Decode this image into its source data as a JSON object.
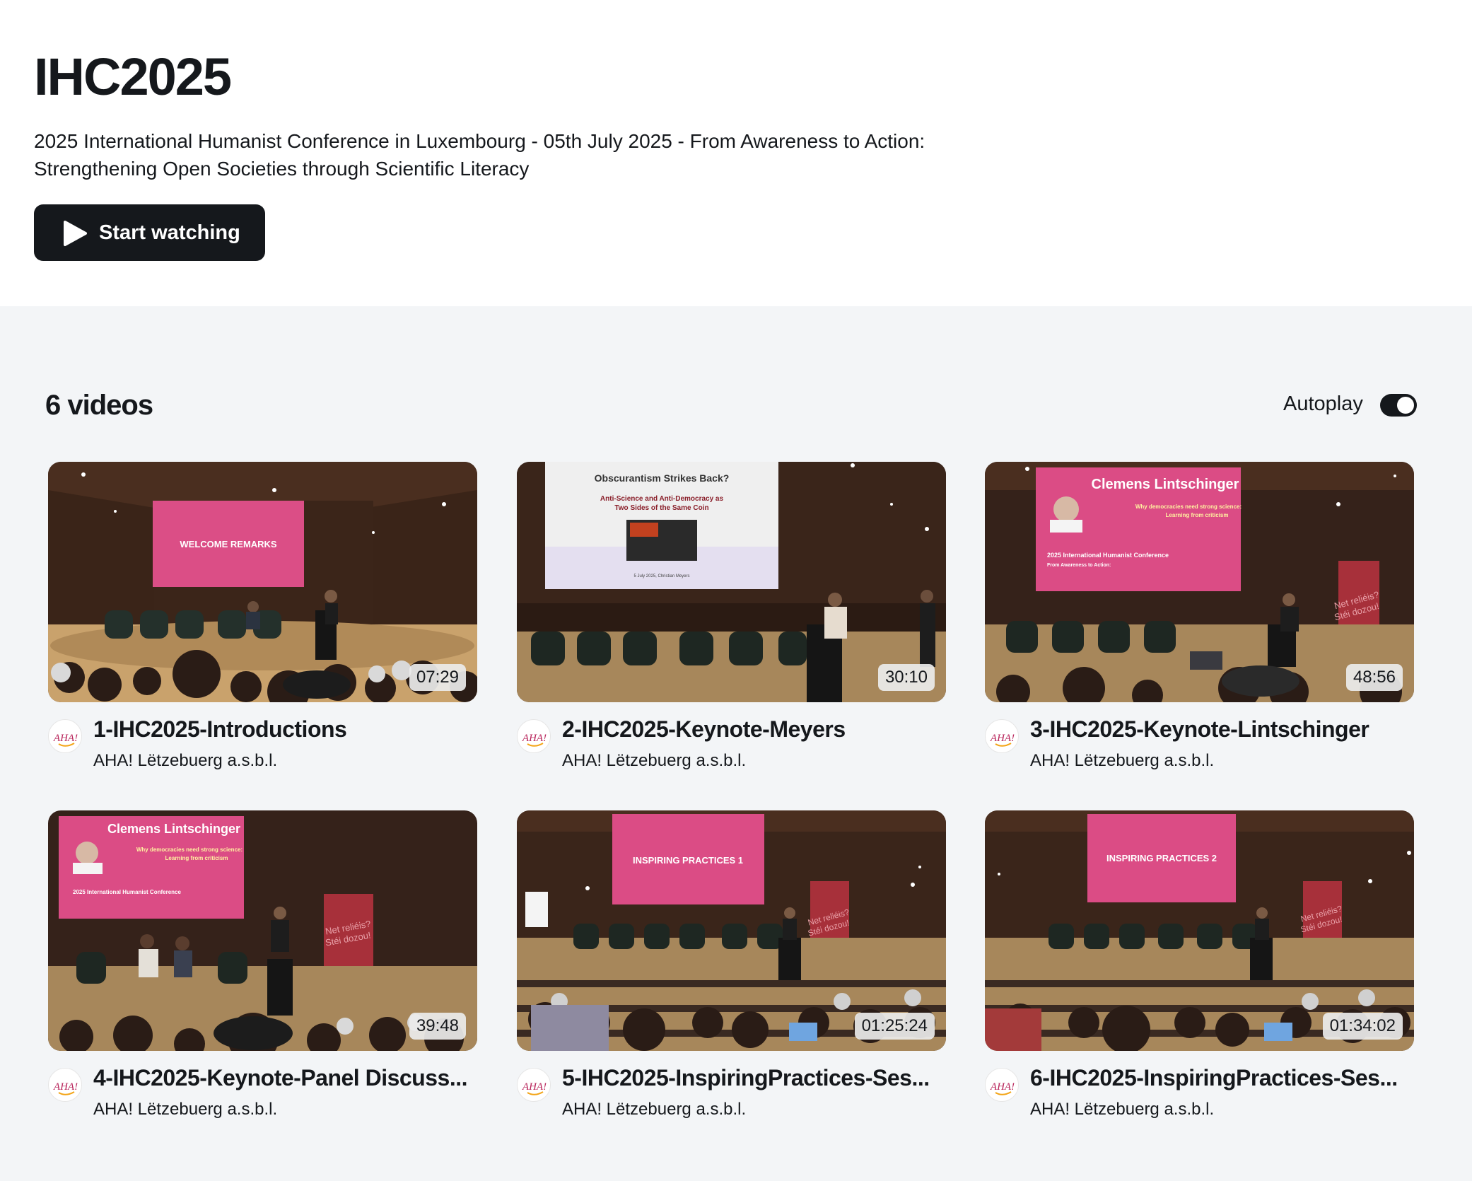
{
  "playlist": {
    "title": "IHC2025",
    "description": "2025 International Humanist Conference in Luxembourg - 05th July 2025 - From Awareness to Action: Strengthening Open Societies through Scientific Literacy",
    "start_label": "Start watching"
  },
  "list": {
    "count_label": "6 videos",
    "autoplay_label": "Autoplay",
    "autoplay_on": true
  },
  "colors": {
    "dark": "#15181c",
    "list_bg": "#f3f5f7",
    "slide_pink": "#d9457f"
  },
  "videos": [
    {
      "title": "1-IHC2025-Introductions",
      "channel": "AHA! Lëtzebuerg a.s.b.l.",
      "duration": "07:29",
      "slide_text": "WELCOME REMARKS"
    },
    {
      "title": "2-IHC2025-Keynote-Meyers",
      "channel": "AHA! Lëtzebuerg a.s.b.l.",
      "duration": "30:10",
      "slide_text": "Obscurantism Strikes Back?",
      "slide_sub": "Anti-Science and Anti-Democracy as Two Sides of the Same Coin"
    },
    {
      "title": "3-IHC2025-Keynote-Lintschinger",
      "channel": "AHA! Lëtzebuerg a.s.b.l.",
      "duration": "48:56",
      "slide_text": "Clemens Lintschinger"
    },
    {
      "title": "4-IHC2025-Keynote-Panel Discuss...",
      "channel": "AHA! Lëtzebuerg a.s.b.l.",
      "duration": "39:48",
      "slide_text": "Clemens Lintschinger"
    },
    {
      "title": "5-IHC2025-InspiringPractices-Ses...",
      "channel": "AHA! Lëtzebuerg a.s.b.l.",
      "duration": "01:25:24",
      "slide_text": "INSPIRING PRACTICES 1"
    },
    {
      "title": "6-IHC2025-InspiringPractices-Ses...",
      "channel": "AHA! Lëtzebuerg a.s.b.l.",
      "duration": "01:34:02",
      "slide_text": "INSPIRING PRACTICES 2"
    }
  ],
  "icons": {
    "play": "play-icon",
    "avatar": "aha-logo-avatar"
  }
}
